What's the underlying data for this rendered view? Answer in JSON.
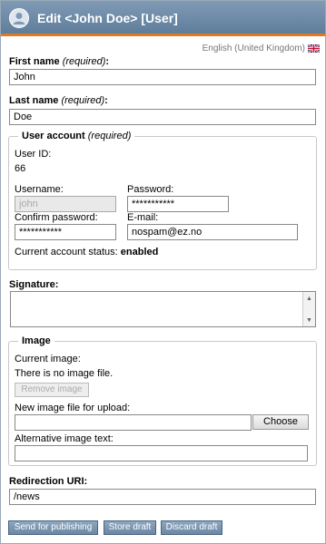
{
  "header": {
    "title": "Edit <John Doe> [User]",
    "icon": "user-icon"
  },
  "language": {
    "name": "English (United Kingdom)",
    "flag_icon": "uk-flag-icon"
  },
  "first_name": {
    "label": "First name",
    "required": "(required)",
    "value": "John"
  },
  "last_name": {
    "label": "Last name",
    "required": "(required)",
    "value": "Doe"
  },
  "user_account": {
    "legend": "User account",
    "required": "(required)",
    "user_id_label": "User ID:",
    "user_id": "66",
    "username_label": "Username:",
    "username_value": "john",
    "password_label": "Password:",
    "password_value": "***********",
    "confirm_label": "Confirm password:",
    "confirm_value": "***********",
    "email_label": "E-mail:",
    "email_value": "nospam@ez.no",
    "status_label": "Current account status:",
    "status_value": "enabled"
  },
  "signature": {
    "label": "Signature:",
    "value": ""
  },
  "image": {
    "legend": "Image",
    "current_label": "Current image:",
    "no_image_text": "There is no image file.",
    "remove_button": "Remove image",
    "upload_label": "New image file for upload:",
    "upload_value": "",
    "choose_button": "Choose",
    "alt_label": "Alternative image text:",
    "alt_value": ""
  },
  "redirection": {
    "label": "Redirection URI:",
    "value": "/news"
  },
  "actions": {
    "publish": "Send for publishing",
    "store": "Store draft",
    "discard": "Discard draft"
  }
}
